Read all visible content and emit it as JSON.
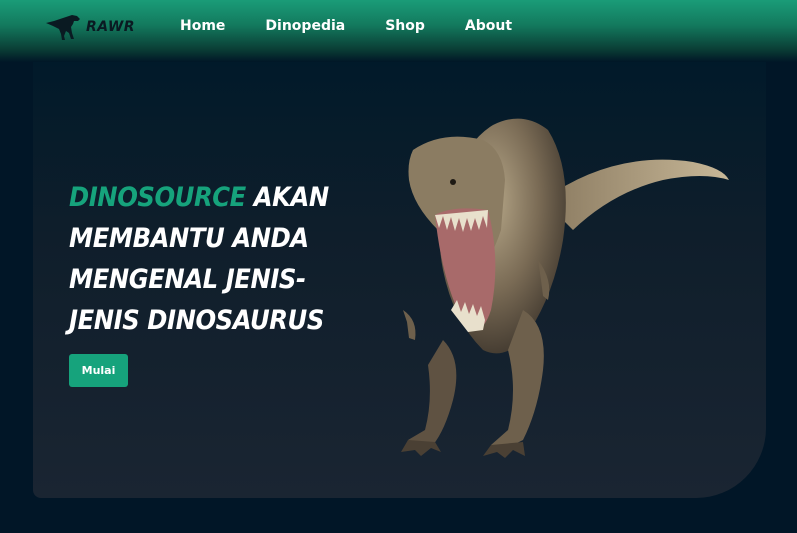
{
  "brand": {
    "logo_text": "RAWR",
    "logo_icon": "t-rex-silhouette-icon"
  },
  "nav": {
    "items": [
      {
        "label": "Home"
      },
      {
        "label": "Dinopedia"
      },
      {
        "label": "Shop"
      },
      {
        "label": "About"
      }
    ]
  },
  "hero": {
    "headline_brand": "DINOSOURCE",
    "headline_rest": "AKAN MEMBANTU ANDA MENGENAL JENIS-JENIS DINOSAURUS",
    "cta_label": "Mulai",
    "image": "tyrannosaurus-rex-photo"
  },
  "colors": {
    "accent": "#16a37c",
    "background": "#011627",
    "card": "#1a2532",
    "text": "#ffffff"
  }
}
